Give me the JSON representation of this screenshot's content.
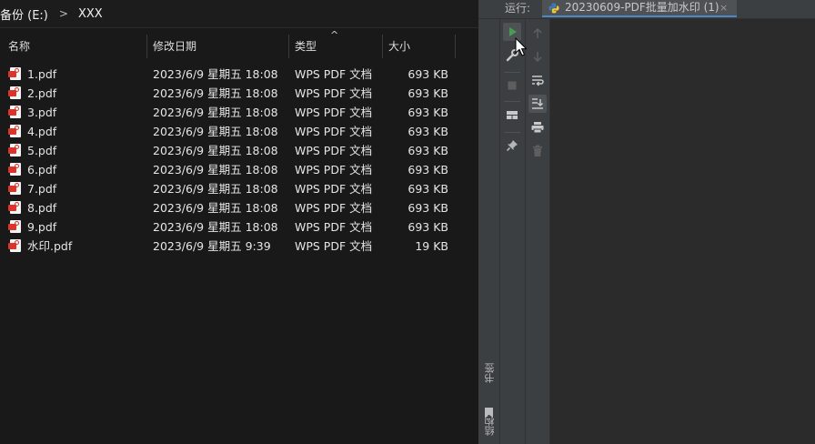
{
  "explorer": {
    "breadcrumb": [
      "备份 (E:)",
      "XXX"
    ],
    "columns": {
      "name": "名称",
      "modified": "修改日期",
      "type": "类型",
      "size": "大小"
    },
    "sort_indicator": "^",
    "files": [
      {
        "name": "1.pdf",
        "modified": "2023/6/9 星期五 18:08",
        "type": "WPS PDF 文档",
        "size": "693 KB"
      },
      {
        "name": "2.pdf",
        "modified": "2023/6/9 星期五 18:08",
        "type": "WPS PDF 文档",
        "size": "693 KB"
      },
      {
        "name": "3.pdf",
        "modified": "2023/6/9 星期五 18:08",
        "type": "WPS PDF 文档",
        "size": "693 KB"
      },
      {
        "name": "4.pdf",
        "modified": "2023/6/9 星期五 18:08",
        "type": "WPS PDF 文档",
        "size": "693 KB"
      },
      {
        "name": "5.pdf",
        "modified": "2023/6/9 星期五 18:08",
        "type": "WPS PDF 文档",
        "size": "693 KB"
      },
      {
        "name": "6.pdf",
        "modified": "2023/6/9 星期五 18:08",
        "type": "WPS PDF 文档",
        "size": "693 KB"
      },
      {
        "name": "7.pdf",
        "modified": "2023/6/9 星期五 18:08",
        "type": "WPS PDF 文档",
        "size": "693 KB"
      },
      {
        "name": "8.pdf",
        "modified": "2023/6/9 星期五 18:08",
        "type": "WPS PDF 文档",
        "size": "693 KB"
      },
      {
        "name": "9.pdf",
        "modified": "2023/6/9 星期五 18:08",
        "type": "WPS PDF 文档",
        "size": "693 KB"
      },
      {
        "name": "水印.pdf",
        "modified": "2023/6/9 星期五 9:39",
        "type": "WPS PDF 文档",
        "size": "19 KB"
      }
    ],
    "file_icon": "pdf-file-icon"
  },
  "ide": {
    "run_label": "运行:",
    "run_tab": {
      "title": "20230609-PDF批量加水印 (1)",
      "close": "×",
      "icon": "python-icon"
    },
    "side_labels": {
      "bookmarks": "书签",
      "structure": "结构"
    },
    "toolbar_left": [
      "rerun-icon",
      "wrench-icon",
      "stop-icon",
      "layout-icon",
      "pin-icon"
    ],
    "toolbar_right": [
      "up-arrow-icon",
      "down-arrow-icon",
      "soft-wrap-icon",
      "scroll-to-end-icon",
      "print-icon",
      "trash-icon"
    ]
  },
  "colors": {
    "explorer_bg": "#191919",
    "ide_panel": "#3c3f41",
    "ide_console": "#2b2b2b",
    "pdf_red": "#d9352a",
    "tab_underline": "#4a88c7"
  }
}
